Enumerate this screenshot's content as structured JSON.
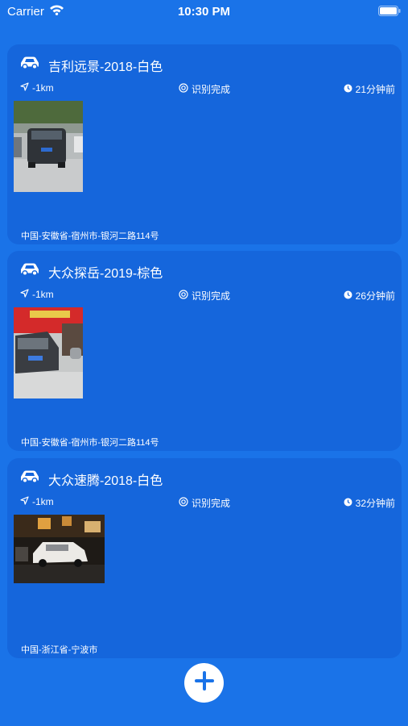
{
  "status_bar": {
    "carrier": "Carrier",
    "time": "10:30 PM"
  },
  "cards": [
    {
      "title": "吉利远景-2018-白色",
      "distance": "-1km",
      "status": "识别完成",
      "time_ago": "21分钟前",
      "address": "中国-安徽省-宿州市-银河二路114号"
    },
    {
      "title": "大众探岳-2019-棕色",
      "distance": "-1km",
      "status": "识别完成",
      "time_ago": "26分钟前",
      "address": "中国-安徽省-宿州市-银河二路114号"
    },
    {
      "title": "大众速腾-2018-白色",
      "distance": "-1km",
      "status": "识别完成",
      "time_ago": "32分钟前",
      "address": "中国-浙江省-宁波市"
    }
  ],
  "icons": {
    "car": "car-icon",
    "location": "location-arrow-icon",
    "status": "target-icon",
    "clock": "clock-icon",
    "add": "plus-icon"
  },
  "colors": {
    "background": "#1a73e8",
    "card": "#1566dc",
    "text": "#ffffff",
    "add_button": "#ffffff",
    "plus": "#1a73e8"
  }
}
